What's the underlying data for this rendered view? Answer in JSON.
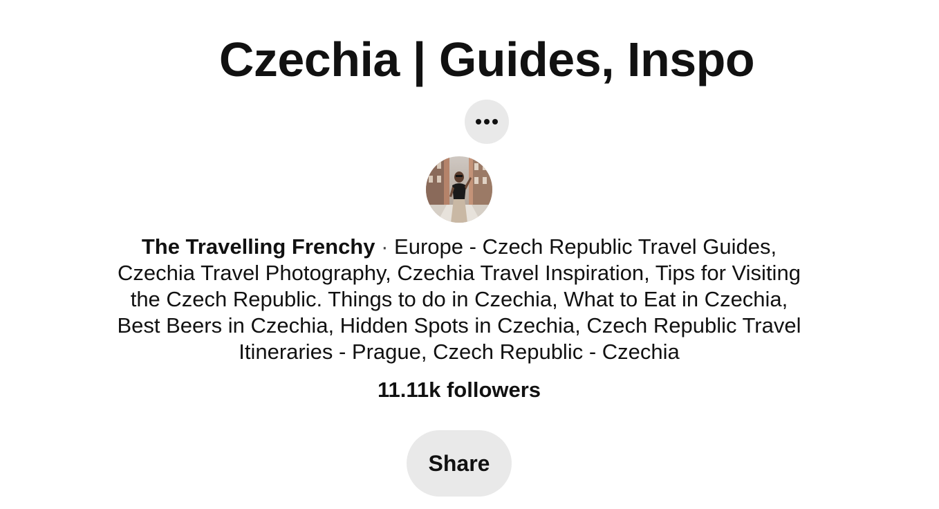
{
  "board": {
    "title": "Czechia | Guides, Inspo",
    "owner_name": "The Travelling Frenchy",
    "separator": " · ",
    "description": "Europe - Czech Republic Travel Guides, Czechia Travel Photography, Czechia Travel Inspiration, Tips for Visiting the Czech Republic. Things to do in Czechia, What to Eat in Czechia, Best Beers in Czechia, Hidden Spots in Czechia, Czech Republic Travel Itineraries - Prague, Czech Republic - Czechia",
    "followers": "11.11k followers"
  },
  "actions": {
    "more_icon": "ellipsis-icon",
    "share_label": "Share"
  },
  "colors": {
    "button_bg": "#e9e9e9",
    "text": "#111111"
  }
}
